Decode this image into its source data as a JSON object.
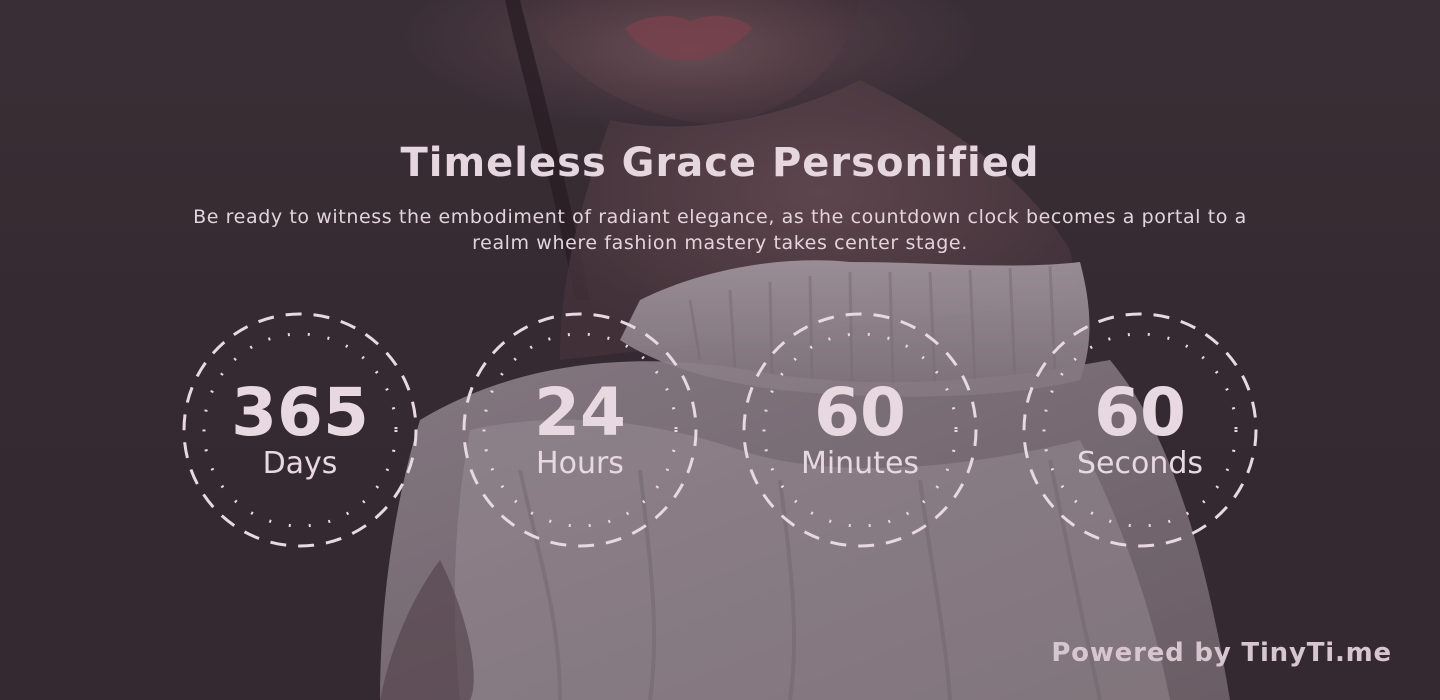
{
  "hero": {
    "title": "Timeless Grace Personified",
    "subtitle": "Be ready to witness the embodiment of radiant elegance, as the countdown clock becomes a portal to a realm where fashion mastery takes center stage."
  },
  "countdown": [
    {
      "value": "365",
      "label": "Days"
    },
    {
      "value": "24",
      "label": "Hours"
    },
    {
      "value": "60",
      "label": "Minutes"
    },
    {
      "value": "60",
      "label": "Seconds"
    }
  ],
  "footer": {
    "powered_by": "Powered by TinyTi.me"
  },
  "colors": {
    "text": "#e8d8e0",
    "ring": "#e8d8e0",
    "overlay": "#3d3139"
  }
}
